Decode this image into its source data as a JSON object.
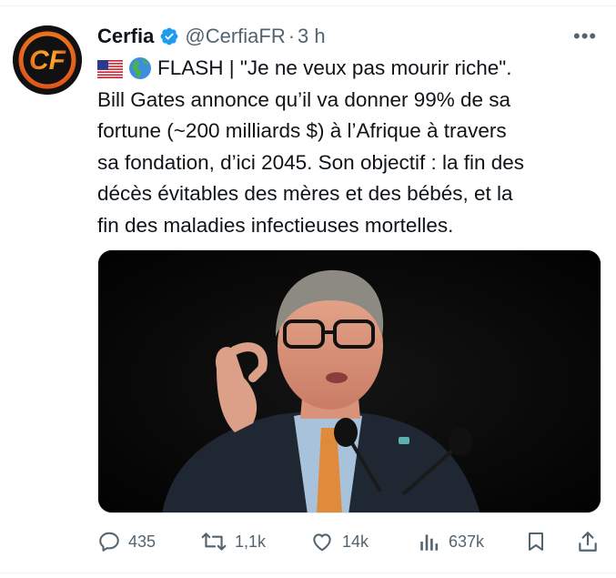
{
  "tweet": {
    "author_name": "Cerfia",
    "handle": "@CerfiaFR",
    "separator": "·",
    "time": "3 h",
    "more_label": "•••",
    "avatar_letters": "CF",
    "lines": [
      "FLASH | \"Je ne veux pas mourir riche\".",
      "Bill Gates annonce qu’il va donner 99% de sa",
      "fortune (~200 milliards $) à l’Afrique à travers",
      "sa fondation, d’ici 2045. Son objectif : la fin des",
      "décès évitables des mères et des bébés, et la",
      "fin des maladies infectieuses mortelles."
    ],
    "emojis": [
      "us-flag",
      "globe-africa-europe"
    ]
  },
  "actions": {
    "replies": "435",
    "reposts": "1,1k",
    "likes": "14k",
    "views": "637k"
  },
  "colors": {
    "text": "#0f1419",
    "secondary": "#536471",
    "verified": "#1d9bf0",
    "avatar_orange": "#f7931e",
    "avatar_bg": "#111111"
  }
}
